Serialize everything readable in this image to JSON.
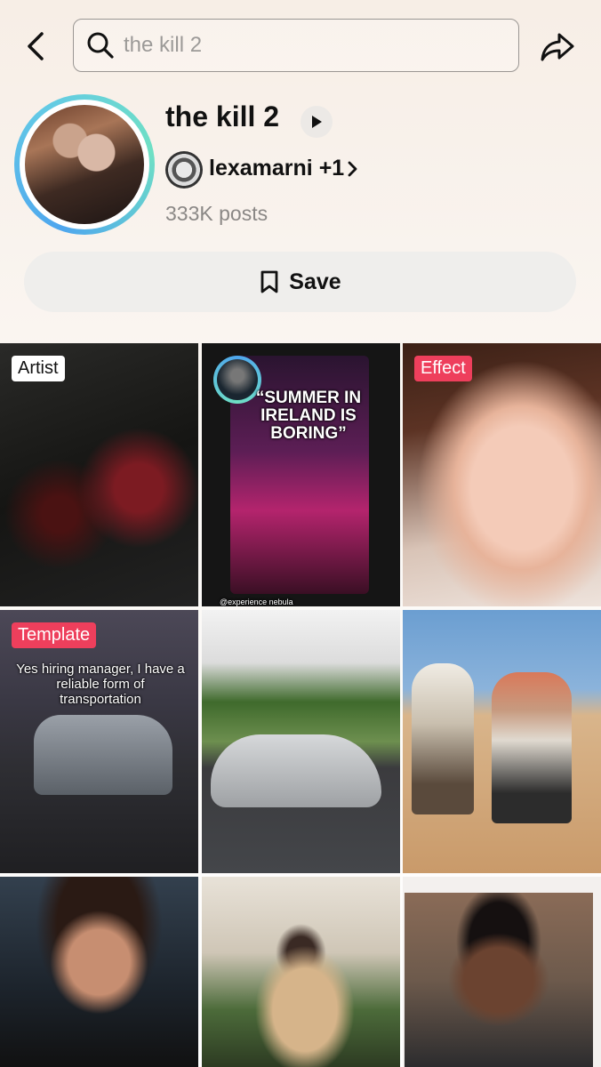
{
  "search": {
    "query": "the kill 2"
  },
  "sound": {
    "title": "the kill 2",
    "creator": "lexamarni",
    "creator_extra": "+1",
    "posts": "333K posts"
  },
  "actions": {
    "save_label": "Save"
  },
  "grid": {
    "badges": {
      "artist": "Artist",
      "effect": "Effect",
      "template": "Template"
    },
    "captions": {
      "summer": "“SUMMER IN IRELAND IS BORING”",
      "summer_credit": "@experience nebula",
      "hiring": "Yes hiring manager, I have a reliable form of transportation"
    }
  },
  "colors": {
    "badge_red": "#ee3f5c",
    "ring_blue": "#4ea6ee",
    "ring_green": "#6fe0c4"
  }
}
